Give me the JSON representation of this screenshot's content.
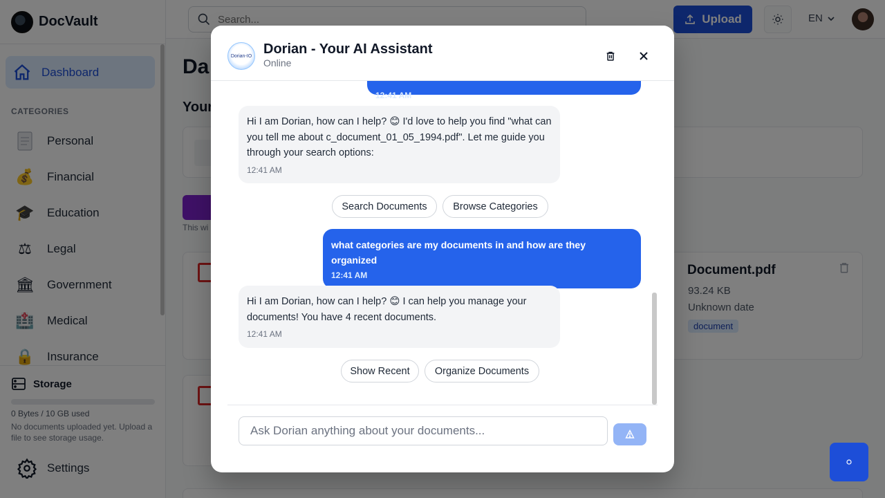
{
  "app": {
    "name": "DocVault"
  },
  "sidebar": {
    "active_item": "Dashboard",
    "categories_heading": "CATEGORIES",
    "categories": [
      {
        "label": "Personal",
        "icon": "document-icon"
      },
      {
        "label": "Financial",
        "icon": "money-bag-icon"
      },
      {
        "label": "Education",
        "icon": "graduation-cap-icon"
      },
      {
        "label": "Legal",
        "icon": "scales-icon"
      },
      {
        "label": "Government",
        "icon": "classical-building-icon"
      },
      {
        "label": "Medical",
        "icon": "hospital-icon"
      },
      {
        "label": "Insurance",
        "icon": "lock-icon"
      }
    ],
    "storage": {
      "title": "Storage",
      "used": "0 Bytes / 10 GB used",
      "used_fraction": 0,
      "note": "No documents uploaded yet. Upload a file to see storage usage."
    },
    "settings_label": "Settings"
  },
  "topbar": {
    "search_placeholder": "Search...",
    "upload_label": "Upload",
    "language": "EN"
  },
  "main": {
    "title": "Da",
    "subtitle": "Your",
    "hint": "This wi",
    "document": {
      "name": "Document.pdf",
      "size": "93.24 KB",
      "date": "Unknown date",
      "tag": "document"
    }
  },
  "chat": {
    "logo_text": "Dorian-IO",
    "title": "Dorian - Your AI Assistant",
    "status": "Online",
    "messages": [
      {
        "from": "user",
        "time": "12:41 AM"
      },
      {
        "from": "bot",
        "text": "Hi I am Dorian, how can I help? 😊 I'd love to help you find \"what can you tell me about c_document_01_05_1994.pdf\". Let me guide you through your search options:",
        "time": "12:41 AM"
      },
      {
        "from": "user",
        "text": "what categories are my documents in and how are they organized",
        "time": "12:41 AM"
      },
      {
        "from": "bot",
        "text": "Hi I am Dorian, how can I help? 😊 I can help you manage your documents! You have 4 recent documents.",
        "time": "12:41 AM"
      }
    ],
    "quick_replies_1": [
      "Search Documents",
      "Browse Categories"
    ],
    "quick_replies_2": [
      "Show Recent",
      "Organize Documents"
    ],
    "input_placeholder": "Ask Dorian anything about your documents..."
  },
  "colors": {
    "accent": "#1d4ed8",
    "user_bubble": "#2563eb",
    "bot_bubble": "#f3f4f6"
  }
}
